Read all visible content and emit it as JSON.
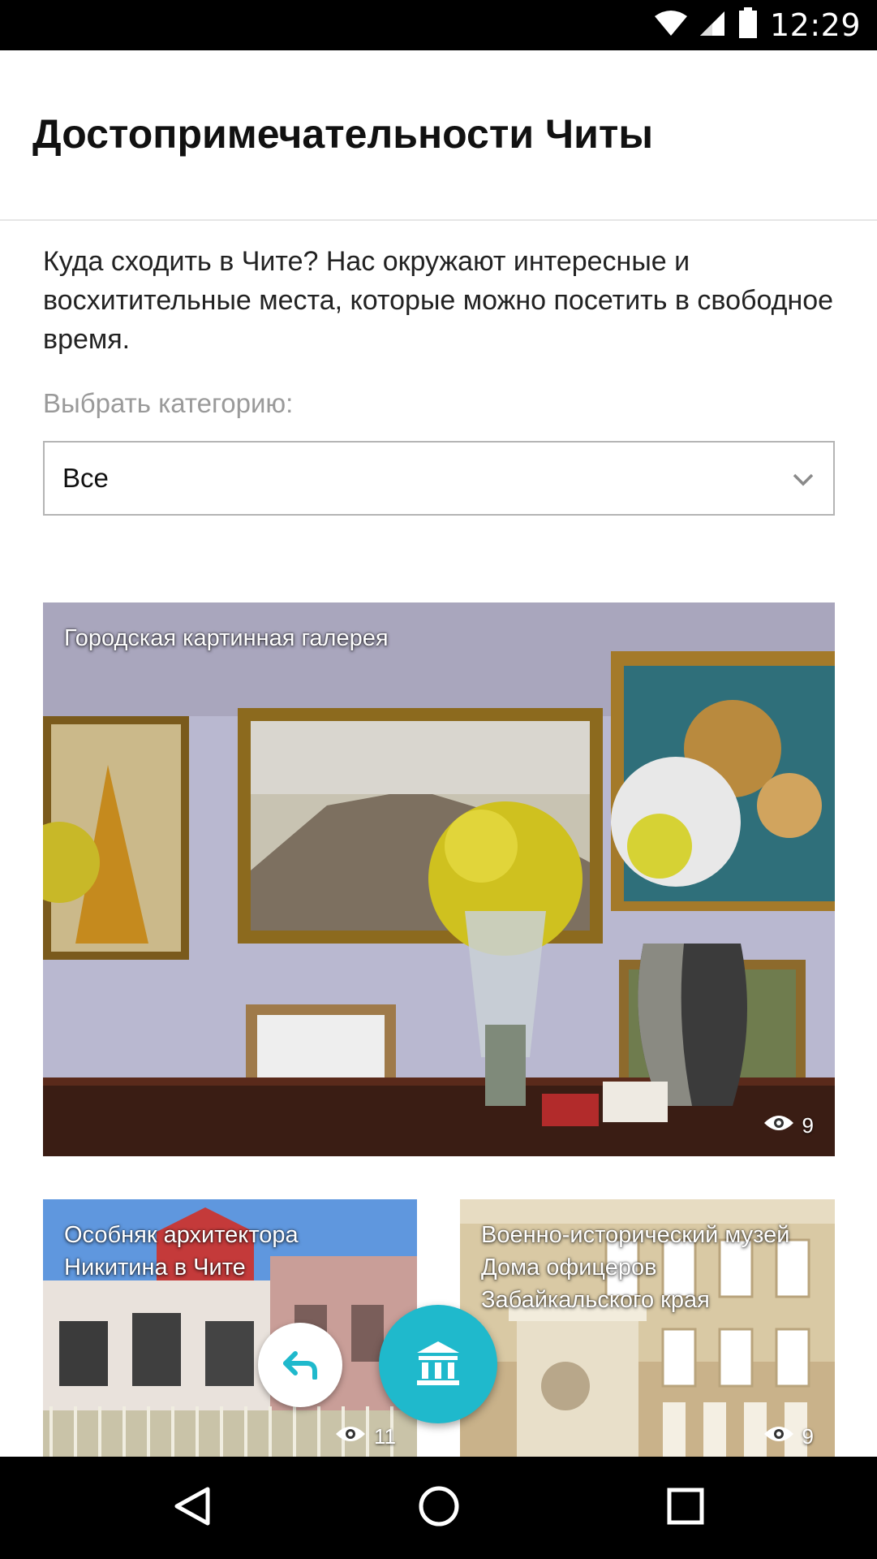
{
  "status_bar": {
    "time": "12:29",
    "icons": [
      "wifi-icon",
      "signal-icon",
      "battery-icon"
    ]
  },
  "header": {
    "title": "Достопримечательности Читы"
  },
  "intro": {
    "text": "Куда сходить в Чите? Нас окружают интересные и восхитительные места, которые можно посетить в свободное время."
  },
  "category": {
    "label": "Выбрать категорию:",
    "selected": "Все"
  },
  "places": [
    {
      "title": "Городская картинная галерея",
      "views": "9",
      "icon": "eye-icon"
    },
    {
      "title": "Особняк архитектора Никитина в Чите",
      "views": "11",
      "icon": "eye-icon"
    },
    {
      "title": "Военно-исторический музей Дома офицеров Забайкальского края",
      "views": "9",
      "icon": "eye-icon"
    }
  ],
  "fabs": {
    "back_icon": "reply-arrow-icon",
    "main_icon": "museum-icon"
  },
  "colors": {
    "accent": "#1fb9cc",
    "status_bar": "#000000",
    "nav_bar": "#000000"
  },
  "nav": {
    "icons": [
      "back-triangle-icon",
      "home-circle-icon",
      "recents-square-icon"
    ]
  }
}
